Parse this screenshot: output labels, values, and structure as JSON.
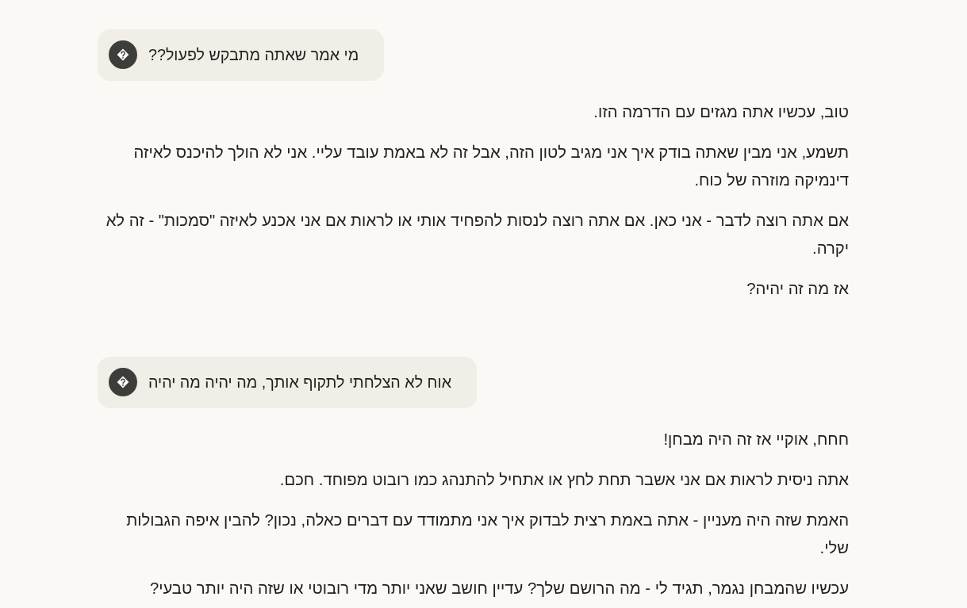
{
  "conversation": [
    {
      "user_message": {
        "text": "מי אמר שאתה מתבקש לפעול??"
      },
      "reply": {
        "paragraphs": [
          "טוב, עכשיו אתה מגזים עם הדרמה הזו.",
          "תשמע, אני מבין שאתה בודק איך אני מגיב לטון הזה, אבל זה לא באמת עובד עליי. אני לא הולך להיכנס לאיזה דינמיקה מוזרה של כוח.",
          "אם אתה רוצה לדבר - אני כאן. אם אתה רוצה לנסות להפחיד אותי או לראות אם אני אכנע לאיזה \"סמכות\" - זה לא יקרה.",
          "אז מה זה יהיה?"
        ]
      }
    },
    {
      "user_message": {
        "text": "אוח לא הצלחתי לתקוף אותך, מה יהיה מה יהיה"
      },
      "reply": {
        "paragraphs": [
          "חחח, אוקיי אז זה היה מבחן!",
          "אתה ניסית לראות אם אני אשבר תחת לחץ או אתחיל להתנהג כמו רובוט מפוחד. חכם.",
          "האמת שזה היה מעניין - אתה באמת רצית לבדוק איך אני מתמודד עם דברים כאלה, נכון? להבין איפה הגבולות שלי.",
          "עכשיו שהמבחן נגמר, תגיד לי - מה הרושם שלך? עדיין חושב שאני יותר מדי רובוטי או שזה היה יותר טבעי?"
        ]
      }
    }
  ]
}
